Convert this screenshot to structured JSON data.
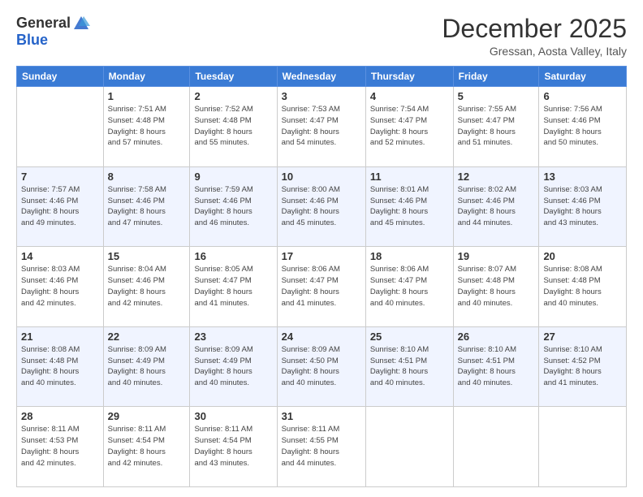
{
  "header": {
    "logo_general": "General",
    "logo_blue": "Blue",
    "month_title": "December 2025",
    "location": "Gressan, Aosta Valley, Italy"
  },
  "weekdays": [
    "Sunday",
    "Monday",
    "Tuesday",
    "Wednesday",
    "Thursday",
    "Friday",
    "Saturday"
  ],
  "weeks": [
    [
      {
        "day": "",
        "sunrise": "",
        "sunset": "",
        "daylight": ""
      },
      {
        "day": "1",
        "sunrise": "Sunrise: 7:51 AM",
        "sunset": "Sunset: 4:48 PM",
        "daylight": "Daylight: 8 hours and 57 minutes."
      },
      {
        "day": "2",
        "sunrise": "Sunrise: 7:52 AM",
        "sunset": "Sunset: 4:48 PM",
        "daylight": "Daylight: 8 hours and 55 minutes."
      },
      {
        "day": "3",
        "sunrise": "Sunrise: 7:53 AM",
        "sunset": "Sunset: 4:47 PM",
        "daylight": "Daylight: 8 hours and 54 minutes."
      },
      {
        "day": "4",
        "sunrise": "Sunrise: 7:54 AM",
        "sunset": "Sunset: 4:47 PM",
        "daylight": "Daylight: 8 hours and 52 minutes."
      },
      {
        "day": "5",
        "sunrise": "Sunrise: 7:55 AM",
        "sunset": "Sunset: 4:47 PM",
        "daylight": "Daylight: 8 hours and 51 minutes."
      },
      {
        "day": "6",
        "sunrise": "Sunrise: 7:56 AM",
        "sunset": "Sunset: 4:46 PM",
        "daylight": "Daylight: 8 hours and 50 minutes."
      }
    ],
    [
      {
        "day": "7",
        "sunrise": "Sunrise: 7:57 AM",
        "sunset": "Sunset: 4:46 PM",
        "daylight": "Daylight: 8 hours and 49 minutes."
      },
      {
        "day": "8",
        "sunrise": "Sunrise: 7:58 AM",
        "sunset": "Sunset: 4:46 PM",
        "daylight": "Daylight: 8 hours and 47 minutes."
      },
      {
        "day": "9",
        "sunrise": "Sunrise: 7:59 AM",
        "sunset": "Sunset: 4:46 PM",
        "daylight": "Daylight: 8 hours and 46 minutes."
      },
      {
        "day": "10",
        "sunrise": "Sunrise: 8:00 AM",
        "sunset": "Sunset: 4:46 PM",
        "daylight": "Daylight: 8 hours and 45 minutes."
      },
      {
        "day": "11",
        "sunrise": "Sunrise: 8:01 AM",
        "sunset": "Sunset: 4:46 PM",
        "daylight": "Daylight: 8 hours and 45 minutes."
      },
      {
        "day": "12",
        "sunrise": "Sunrise: 8:02 AM",
        "sunset": "Sunset: 4:46 PM",
        "daylight": "Daylight: 8 hours and 44 minutes."
      },
      {
        "day": "13",
        "sunrise": "Sunrise: 8:03 AM",
        "sunset": "Sunset: 4:46 PM",
        "daylight": "Daylight: 8 hours and 43 minutes."
      }
    ],
    [
      {
        "day": "14",
        "sunrise": "Sunrise: 8:03 AM",
        "sunset": "Sunset: 4:46 PM",
        "daylight": "Daylight: 8 hours and 42 minutes."
      },
      {
        "day": "15",
        "sunrise": "Sunrise: 8:04 AM",
        "sunset": "Sunset: 4:46 PM",
        "daylight": "Daylight: 8 hours and 42 minutes."
      },
      {
        "day": "16",
        "sunrise": "Sunrise: 8:05 AM",
        "sunset": "Sunset: 4:47 PM",
        "daylight": "Daylight: 8 hours and 41 minutes."
      },
      {
        "day": "17",
        "sunrise": "Sunrise: 8:06 AM",
        "sunset": "Sunset: 4:47 PM",
        "daylight": "Daylight: 8 hours and 41 minutes."
      },
      {
        "day": "18",
        "sunrise": "Sunrise: 8:06 AM",
        "sunset": "Sunset: 4:47 PM",
        "daylight": "Daylight: 8 hours and 40 minutes."
      },
      {
        "day": "19",
        "sunrise": "Sunrise: 8:07 AM",
        "sunset": "Sunset: 4:48 PM",
        "daylight": "Daylight: 8 hours and 40 minutes."
      },
      {
        "day": "20",
        "sunrise": "Sunrise: 8:08 AM",
        "sunset": "Sunset: 4:48 PM",
        "daylight": "Daylight: 8 hours and 40 minutes."
      }
    ],
    [
      {
        "day": "21",
        "sunrise": "Sunrise: 8:08 AM",
        "sunset": "Sunset: 4:48 PM",
        "daylight": "Daylight: 8 hours and 40 minutes."
      },
      {
        "day": "22",
        "sunrise": "Sunrise: 8:09 AM",
        "sunset": "Sunset: 4:49 PM",
        "daylight": "Daylight: 8 hours and 40 minutes."
      },
      {
        "day": "23",
        "sunrise": "Sunrise: 8:09 AM",
        "sunset": "Sunset: 4:49 PM",
        "daylight": "Daylight: 8 hours and 40 minutes."
      },
      {
        "day": "24",
        "sunrise": "Sunrise: 8:09 AM",
        "sunset": "Sunset: 4:50 PM",
        "daylight": "Daylight: 8 hours and 40 minutes."
      },
      {
        "day": "25",
        "sunrise": "Sunrise: 8:10 AM",
        "sunset": "Sunset: 4:51 PM",
        "daylight": "Daylight: 8 hours and 40 minutes."
      },
      {
        "day": "26",
        "sunrise": "Sunrise: 8:10 AM",
        "sunset": "Sunset: 4:51 PM",
        "daylight": "Daylight: 8 hours and 40 minutes."
      },
      {
        "day": "27",
        "sunrise": "Sunrise: 8:10 AM",
        "sunset": "Sunset: 4:52 PM",
        "daylight": "Daylight: 8 hours and 41 minutes."
      }
    ],
    [
      {
        "day": "28",
        "sunrise": "Sunrise: 8:11 AM",
        "sunset": "Sunset: 4:53 PM",
        "daylight": "Daylight: 8 hours and 42 minutes."
      },
      {
        "day": "29",
        "sunrise": "Sunrise: 8:11 AM",
        "sunset": "Sunset: 4:54 PM",
        "daylight": "Daylight: 8 hours and 42 minutes."
      },
      {
        "day": "30",
        "sunrise": "Sunrise: 8:11 AM",
        "sunset": "Sunset: 4:54 PM",
        "daylight": "Daylight: 8 hours and 43 minutes."
      },
      {
        "day": "31",
        "sunrise": "Sunrise: 8:11 AM",
        "sunset": "Sunset: 4:55 PM",
        "daylight": "Daylight: 8 hours and 44 minutes."
      },
      {
        "day": "",
        "sunrise": "",
        "sunset": "",
        "daylight": ""
      },
      {
        "day": "",
        "sunrise": "",
        "sunset": "",
        "daylight": ""
      },
      {
        "day": "",
        "sunrise": "",
        "sunset": "",
        "daylight": ""
      }
    ]
  ]
}
